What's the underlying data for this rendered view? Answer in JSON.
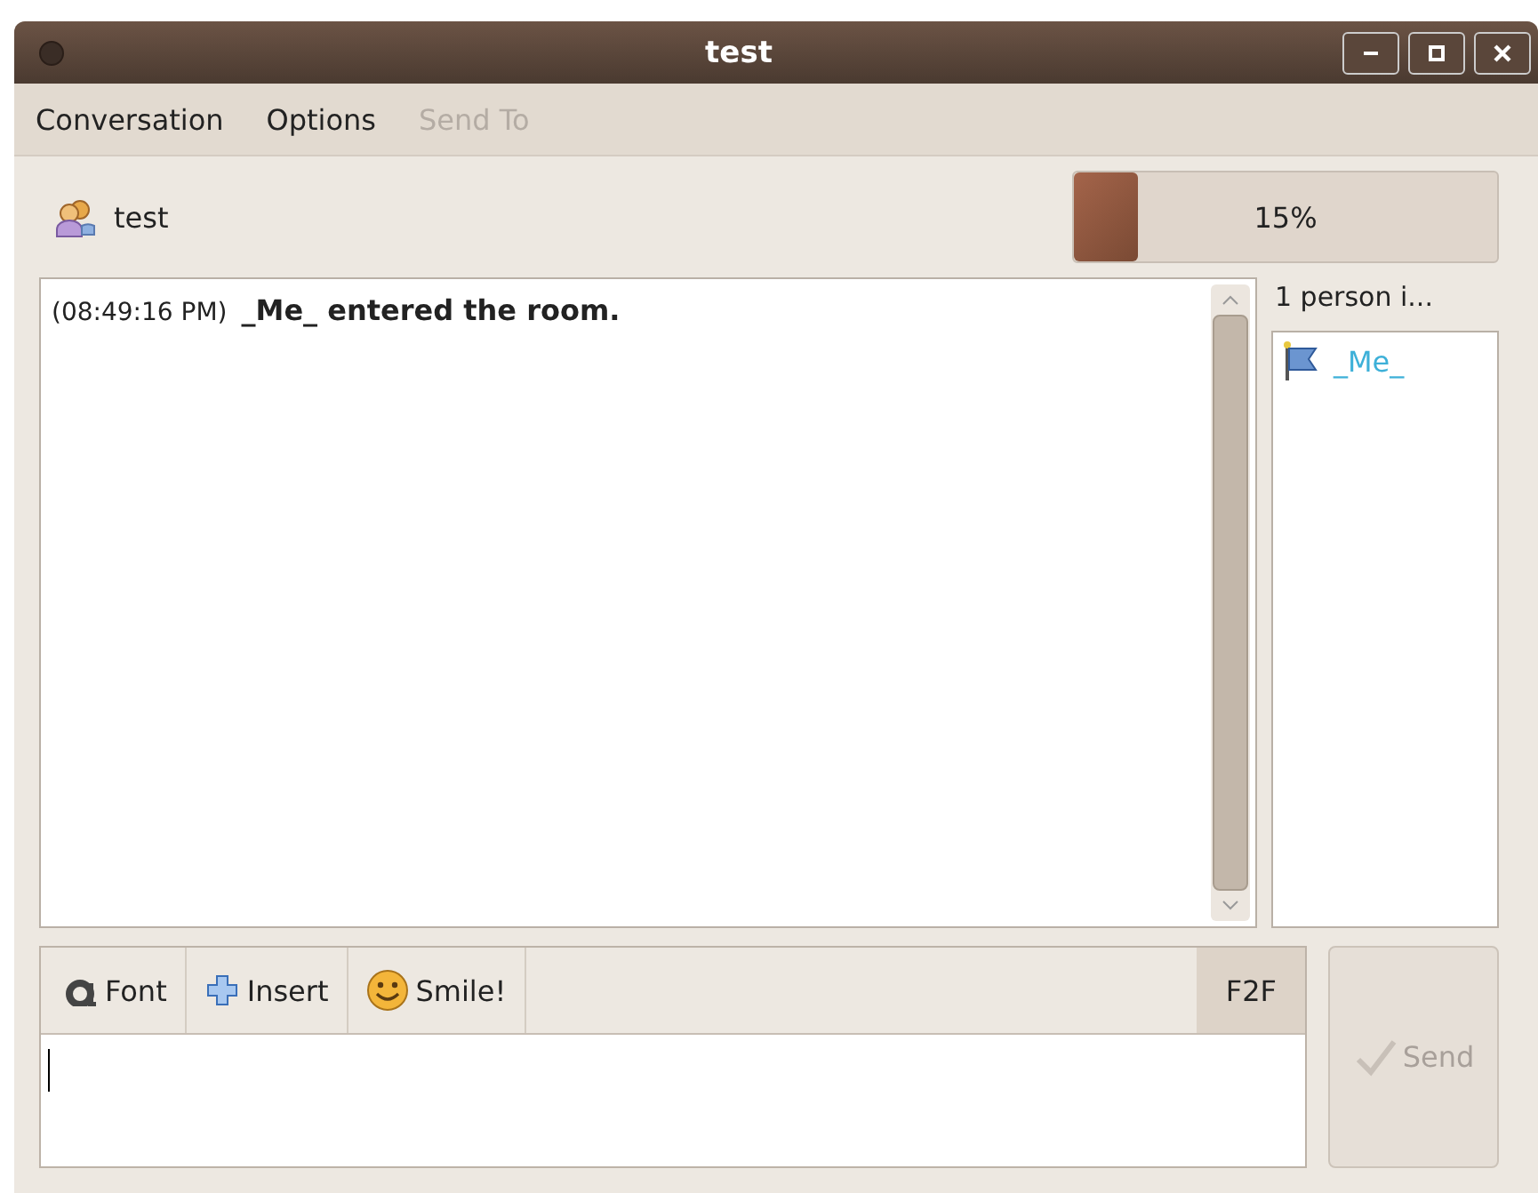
{
  "window": {
    "title": "test"
  },
  "menu": [
    {
      "label": "Conversation",
      "disabled": false
    },
    {
      "label": "Options",
      "disabled": false
    },
    {
      "label": "Send To",
      "disabled": true
    }
  ],
  "header": {
    "name": "test",
    "progress": {
      "level": 0.15,
      "reading": "15%"
    }
  },
  "messages": [
    {
      "time": "(08:49:16 PM)",
      "text": "_Me_ entered the room."
    }
  ],
  "userlist": {
    "heading": "1 person i...",
    "users": [
      {
        "name": "_Me_"
      }
    ]
  },
  "toolbar": [
    {
      "kind": "font",
      "label": "Font"
    },
    {
      "kind": "insert",
      "label": "Insert"
    },
    {
      "kind": "smile",
      "label": "Smile!"
    }
  ],
  "f2f": {
    "label": "F2F",
    "on": true
  },
  "send": {
    "label": "Send",
    "disabled": true
  }
}
